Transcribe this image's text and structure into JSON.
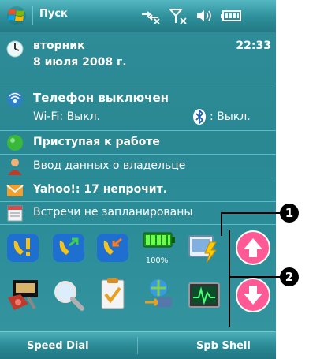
{
  "titlebar": {
    "title": "Пуск",
    "icons": [
      "sync-arrows-icon",
      "signal-off-icon",
      "speaker-icon",
      "battery-icon"
    ]
  },
  "today": {
    "date_day": "вторник",
    "date_full": "8 июля 2008 г.",
    "time": "22:33",
    "phone_title": "Телефон выключен",
    "wifi_status": "Wi-Fi: Выкл.",
    "bluetooth_status": ": Выкл.",
    "getting_started": "Приступая к работе",
    "owner_info": "Ввод данных о владельце",
    "mail": "Yahoo!: 17 непрочит.",
    "calendar": "Встречи не запланированы"
  },
  "shell": {
    "battery_label": "100%",
    "apps_row1": [
      "speed-dial-icon",
      "call-history-icon",
      "call-log-icon",
      "battery-icon",
      "launcher-icon"
    ],
    "apps_row2": [
      "ram-icon",
      "search-icon",
      "tasks-icon",
      "sync-icon",
      "task-manager-icon"
    ],
    "scroll": [
      "scroll-up-button",
      "scroll-down-button"
    ],
    "accent": "#ff5a96"
  },
  "softkeys": {
    "left": "Speed Dial",
    "right": "Spb Shell"
  },
  "callouts": {
    "one": "1",
    "two": "2"
  }
}
